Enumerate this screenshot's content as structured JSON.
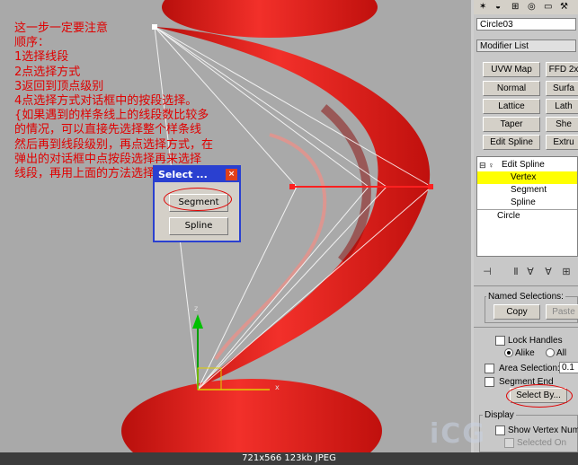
{
  "annotation": {
    "lines": [
      "这一步一定要注意",
      "顺序：",
      "1选择线段",
      "2点选择方式",
      "3返回到顶点级别",
      "4点选择方式对话框中的按段选择。",
      "{如果遇到的样条线上的线段数比较多",
      "的情况，可以直接先选择整个样条线",
      "然后再到线段级别，再点选择方式，在",
      "弹出的对话框中点按段选择再来选择",
      "线段，再用上面的方法选择点。}"
    ]
  },
  "select_dialog": {
    "title": "Select ...",
    "close_glyph": "×",
    "segment_label": "Segment",
    "spline_label": "Spline"
  },
  "status_bar": {
    "text": "721x566  123kb  JPEG"
  },
  "command_panel": {
    "object_name": "Circle03",
    "modifier_list": "Modifier List",
    "buttons": [
      {
        "label": "UVW Map"
      },
      {
        "label": "FFD 2x"
      },
      {
        "label": "Normal"
      },
      {
        "label": "Surfa"
      },
      {
        "label": "Lattice"
      },
      {
        "label": "Lath"
      },
      {
        "label": "Taper"
      },
      {
        "label": "She"
      },
      {
        "label": "Edit Spline"
      },
      {
        "label": "Extru"
      }
    ],
    "stack": {
      "edit_spline": "Edit Spline",
      "vertex": "Vertex",
      "segment": "Segment",
      "spline": "Spline",
      "circle": "Circle"
    },
    "named_selections": {
      "label": "Named Selections:",
      "copy": "Copy",
      "paste": "Paste"
    },
    "lock_handles": "Lock Handles",
    "alike": "Alike",
    "all": "All",
    "area_selection": "Area Selection:",
    "area_value": "0.1",
    "segment_end": "Segment End",
    "select_by": "Select By...",
    "display": "Display",
    "show_vertex_numbers": "Show Vertex Num",
    "selected_only": "Selected On"
  },
  "watermark": "iCG",
  "colors": {
    "annotation": "#e00000",
    "dialog_frame": "#2a40d0",
    "selected_row": "#ffff00",
    "object_red": "#e8221e"
  }
}
